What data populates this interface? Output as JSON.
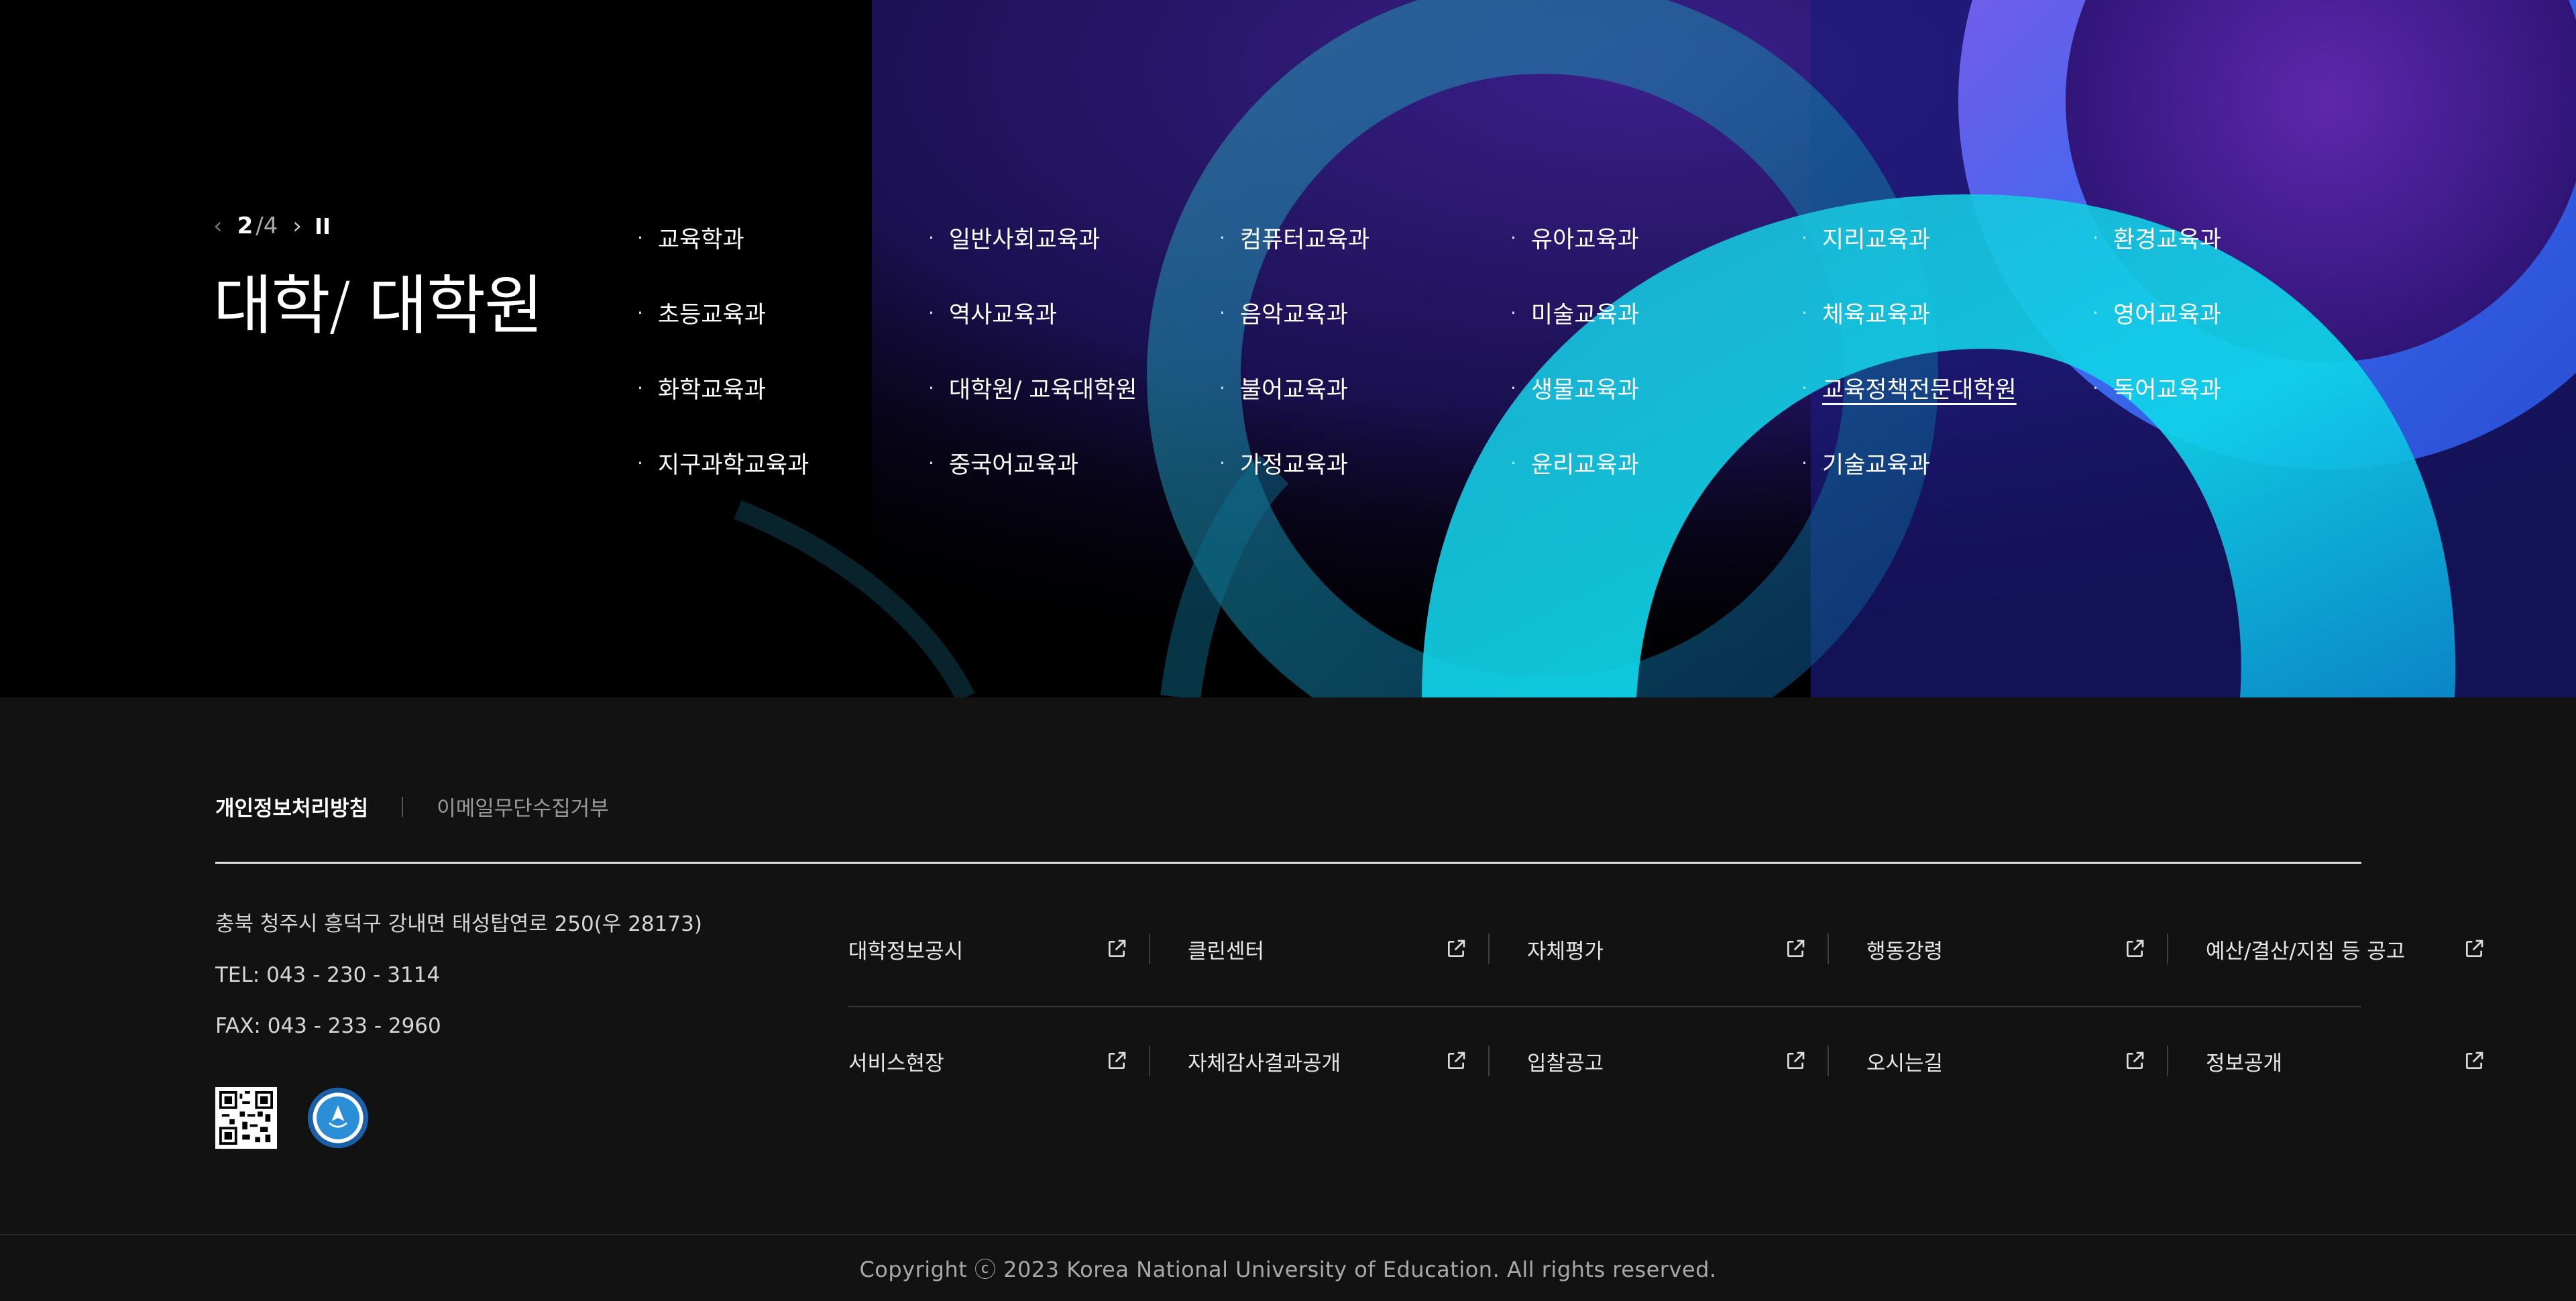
{
  "hero": {
    "title": "대학/ 대학원",
    "carousel": {
      "current": "2",
      "total": "/4",
      "prev_symbol": "‹",
      "next_symbol": "›"
    },
    "departments": [
      {
        "label": "교육학과"
      },
      {
        "label": "일반사회교육과"
      },
      {
        "label": "컴퓨터교육과"
      },
      {
        "label": "유아교육과"
      },
      {
        "label": "지리교육과"
      },
      {
        "label": "환경교육과"
      },
      {
        "label": "초등교육과"
      },
      {
        "label": "역사교육과"
      },
      {
        "label": "음악교육과"
      },
      {
        "label": "미술교육과"
      },
      {
        "label": "체육교육과"
      },
      {
        "label": "영어교육과"
      },
      {
        "label": "화학교육과"
      },
      {
        "label": "대학원/ 교육대학원"
      },
      {
        "label": "불어교육과"
      },
      {
        "label": "생물교육과"
      },
      {
        "label": "교육정책전문대학원",
        "active": true
      },
      {
        "label": "독어교육과"
      },
      {
        "label": "지구과학교육과"
      },
      {
        "label": "중국어교육과"
      },
      {
        "label": "가정교육과"
      },
      {
        "label": "윤리교육과"
      },
      {
        "label": "기술교육과"
      }
    ],
    "bullet": "·"
  },
  "footer": {
    "policy": {
      "privacy": "개인정보처리방침",
      "email_refusal": "이메일무단수집거부"
    },
    "contact": {
      "address": "충북 청주시 흥덕구 강내면 태성탑연로 250(우 28173)",
      "tel": "TEL: 043 - 230 - 3114",
      "fax": "FAX: 043 - 233 - 2960"
    },
    "quick_links_row1": [
      "대학정보공시",
      "클린센터",
      "자체평가",
      "행동강령",
      "예산/결산/지침 등 공고"
    ],
    "quick_links_row2": [
      "서비스현장",
      "자체감사결과공개",
      "입찰공고",
      "오시는길",
      "정보공개"
    ],
    "copyright": "Copyright ⓒ 2023 Korea National University of Education. All rights reserved."
  },
  "colors": {
    "hero_bg": "#000000",
    "footer_bg": "#121212",
    "accent_cyan": "#19c3e0",
    "accent_blue": "#2a6cf0",
    "accent_purple": "#4a2a9a"
  }
}
